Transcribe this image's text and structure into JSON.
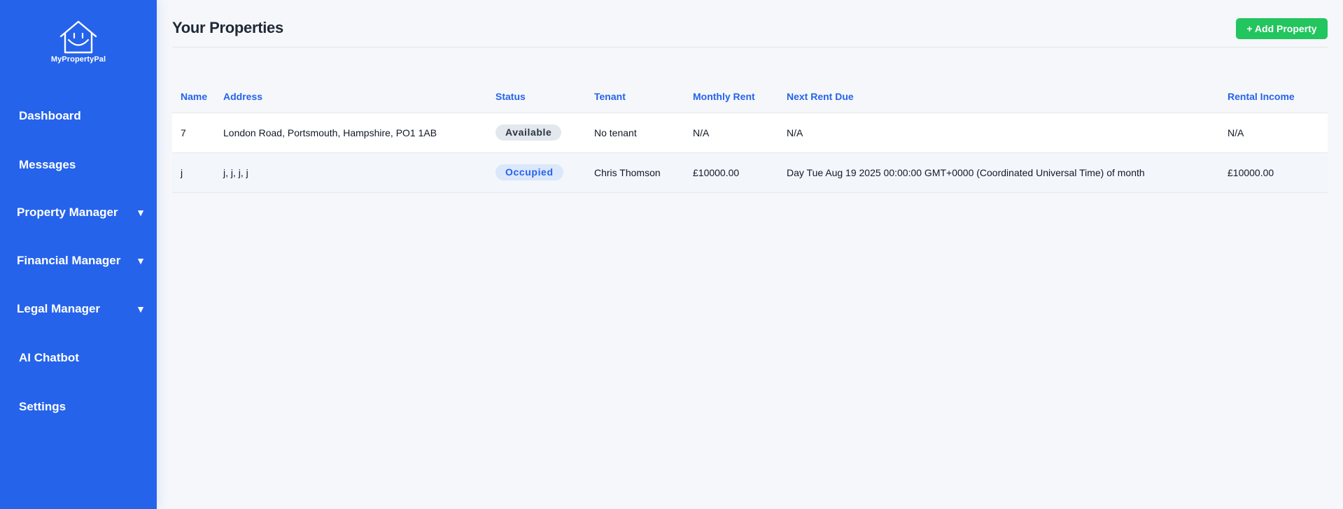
{
  "brand": {
    "name": "MyPropertyPal"
  },
  "nav": {
    "dashboard": "Dashboard",
    "messages": "Messages",
    "property_manager": "Property Manager",
    "financial_manager": "Financial Manager",
    "legal_manager": "Legal Manager",
    "ai_chatbot": "AI Chatbot",
    "settings": "Settings",
    "caret": "▼"
  },
  "page": {
    "title": "Your Properties",
    "add_button": "+ Add Property"
  },
  "table": {
    "headers": {
      "name": "Name",
      "address": "Address",
      "status": "Status",
      "tenant": "Tenant",
      "monthly_rent": "Monthly Rent",
      "next_rent_due": "Next Rent Due",
      "rental_income": "Rental Income"
    },
    "rows": [
      {
        "name": "7",
        "address": "London Road, Portsmouth, Hampshire, PO1 1AB",
        "status": "Available",
        "tenant": "No tenant",
        "monthly_rent": "N/A",
        "next_rent_due": "N/A",
        "rental_income": "N/A"
      },
      {
        "name": "j",
        "address": "j, j, j, j",
        "status": "Occupied",
        "tenant": "Chris Thomson",
        "monthly_rent": "£10000.00",
        "next_rent_due": "Day Tue Aug 19 2025 00:00:00 GMT+0000 (Coordinated Universal Time) of month",
        "rental_income": "£10000.00"
      }
    ]
  },
  "colors": {
    "sidebar": "#2563eb",
    "accent": "#2563eb",
    "add_button": "#22c55e",
    "background": "#f5f7fa"
  }
}
